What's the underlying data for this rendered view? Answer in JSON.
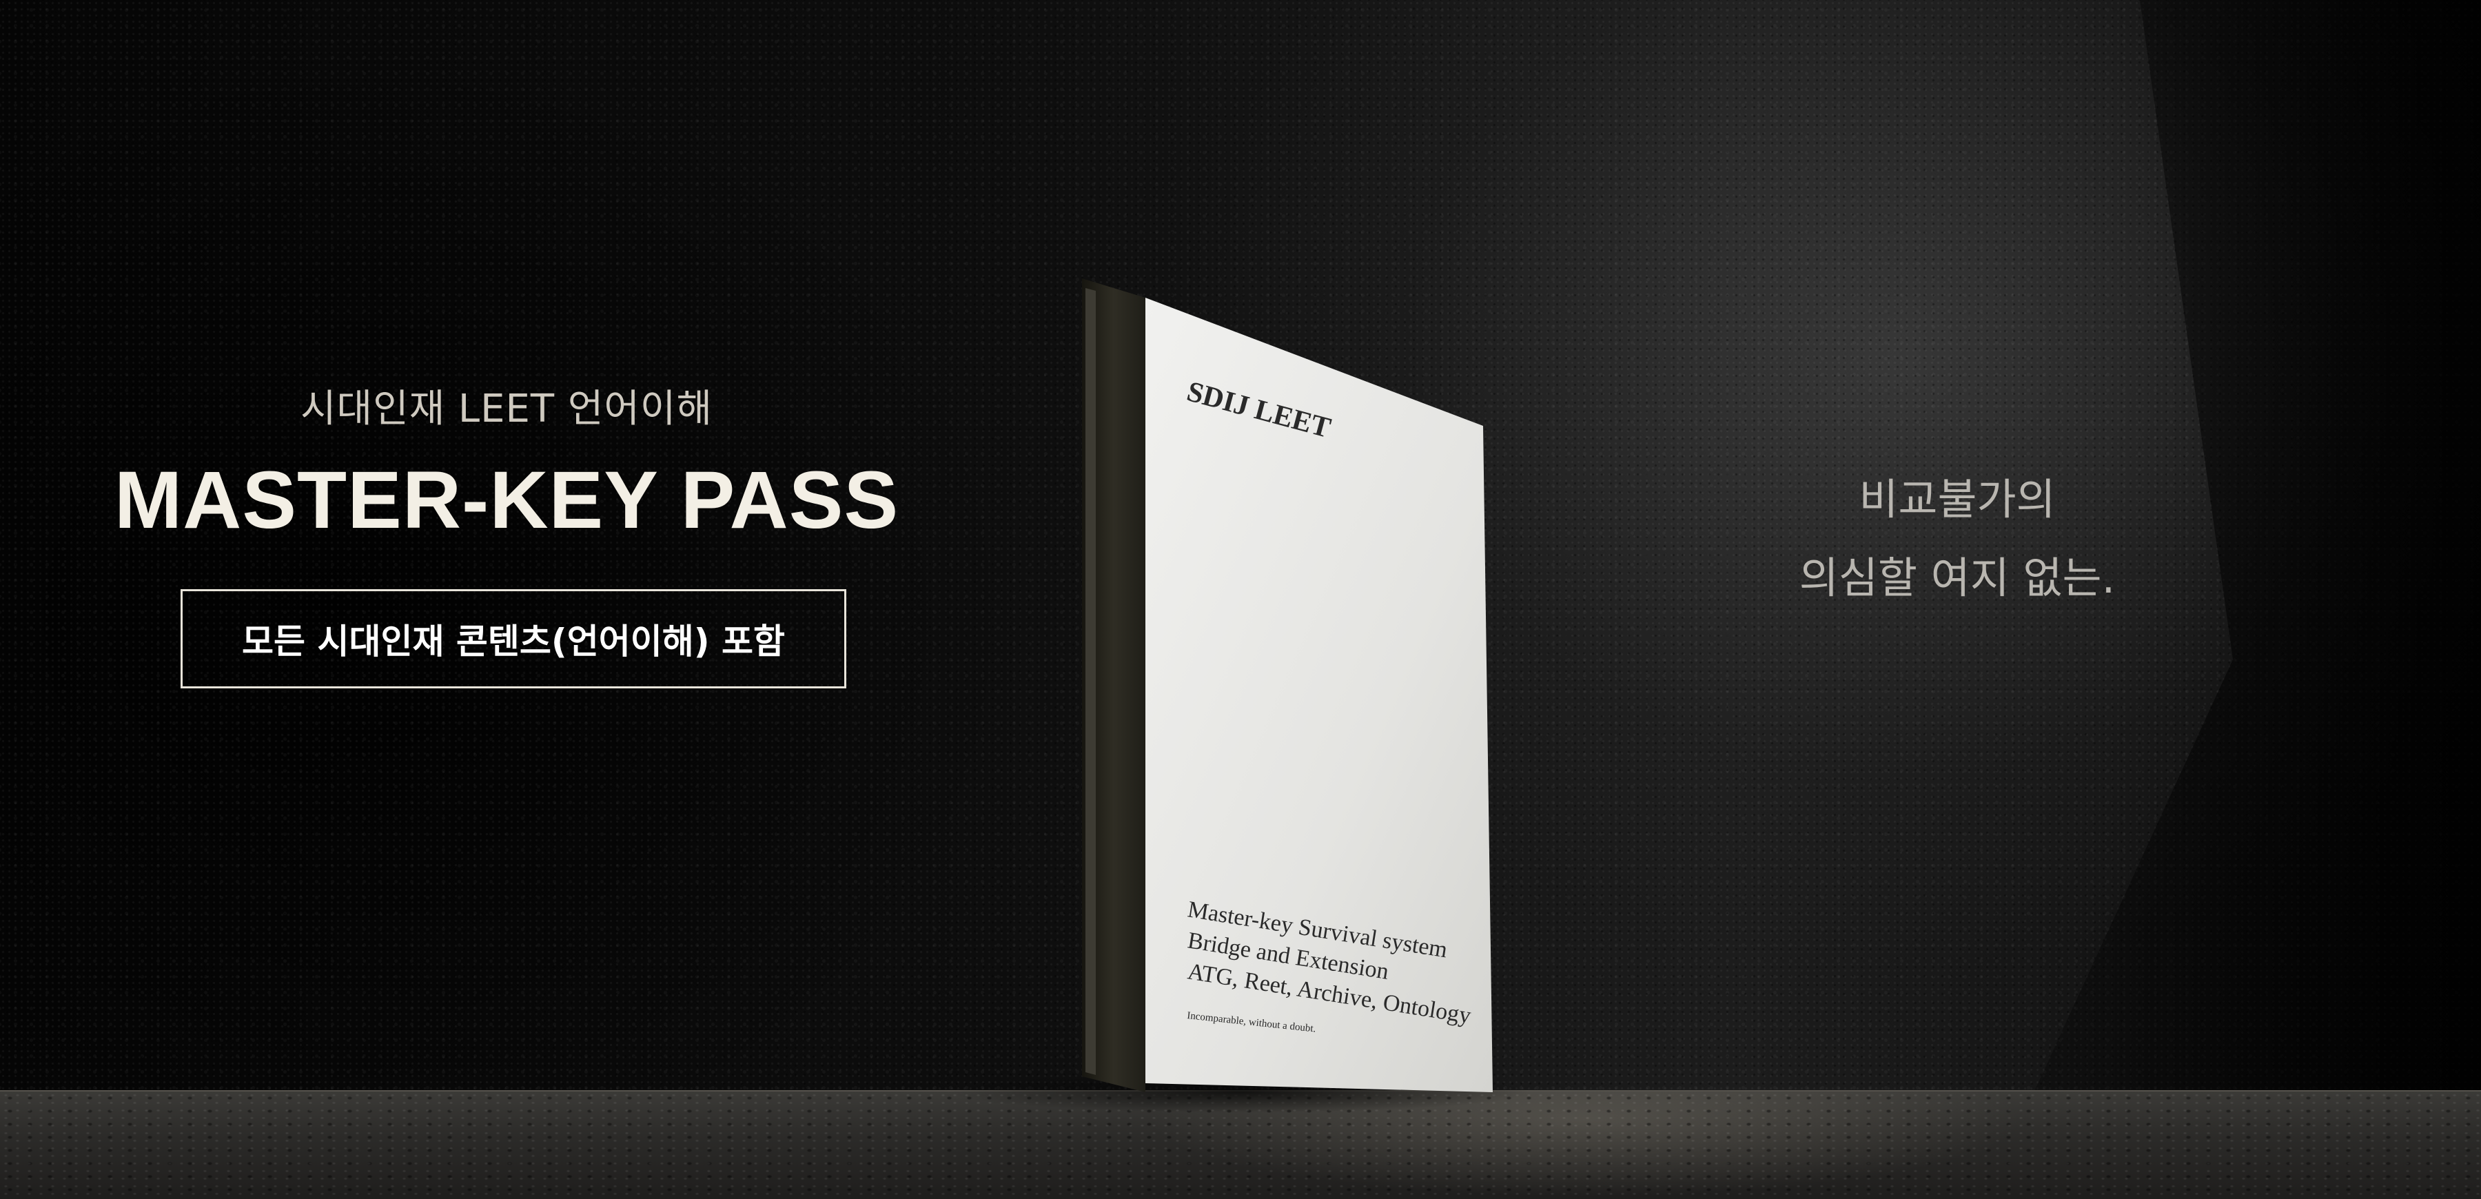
{
  "hero": {
    "subtitle": "시대인재 LEET 언어이해",
    "title": "MASTER-KEY PASS",
    "cta_label": "모든 시대인재 콘텐츠(언어이해) 포함",
    "tagline_line1": "비교불가의",
    "tagline_line2": "의심할 여지 없는."
  },
  "book": {
    "brand": "SDIJ LEET",
    "line1": "Master-key Survival system",
    "line2": "Bridge and Extension",
    "line3": "ATG, Reet, Archive, Ontology",
    "small_text": "Incomparable, without a doubt."
  },
  "colors": {
    "background": "#0a0a0a",
    "text_primary": "#f3efe5",
    "text_secondary": "#cfcac0",
    "cover": "#e9e9e7",
    "spine": "#2b2a25"
  }
}
